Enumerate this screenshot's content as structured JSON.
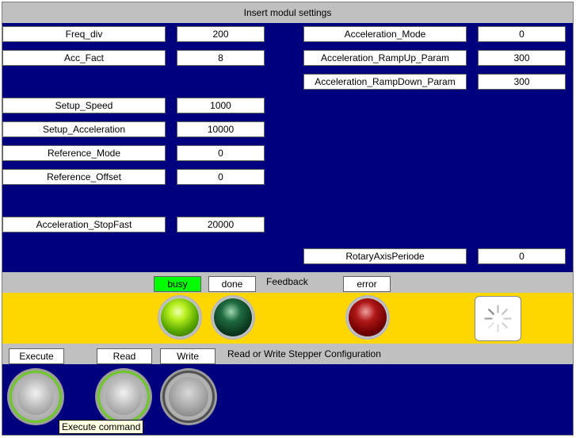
{
  "title": "Insert modul settings",
  "left_params": [
    {
      "label": "Freq_div",
      "value": "200"
    },
    {
      "label": "Acc_Fact",
      "value": "8"
    },
    {
      "label": "Setup_Speed",
      "value": "1000"
    },
    {
      "label": "Setup_Acceleration",
      "value": "10000"
    },
    {
      "label": "Reference_Mode",
      "value": "0"
    },
    {
      "label": "Reference_Offset",
      "value": "0"
    },
    {
      "label": "Acceleration_StopFast",
      "value": "20000"
    }
  ],
  "right_params": [
    {
      "label": "Acceleration_Mode",
      "value": "0"
    },
    {
      "label": "Acceleration_RampUp_Param",
      "value": "300"
    },
    {
      "label": "Acceleration_RampDown_Param",
      "value": "300"
    },
    {
      "label": "RotaryAxisPeriode",
      "value": "0"
    }
  ],
  "feedback": {
    "busy": "busy",
    "done": "done",
    "title": "Feedback",
    "error": "error",
    "busy_color": "#00ff00"
  },
  "command": {
    "execute": "Execute",
    "read": "Read",
    "write": "Write",
    "title": "Read or Write Stepper Configuration",
    "tooltip": "Execute command"
  },
  "colors": {
    "background": "#00007f",
    "feedback_band": "#ffd700",
    "bar": "#c0c0c0"
  }
}
